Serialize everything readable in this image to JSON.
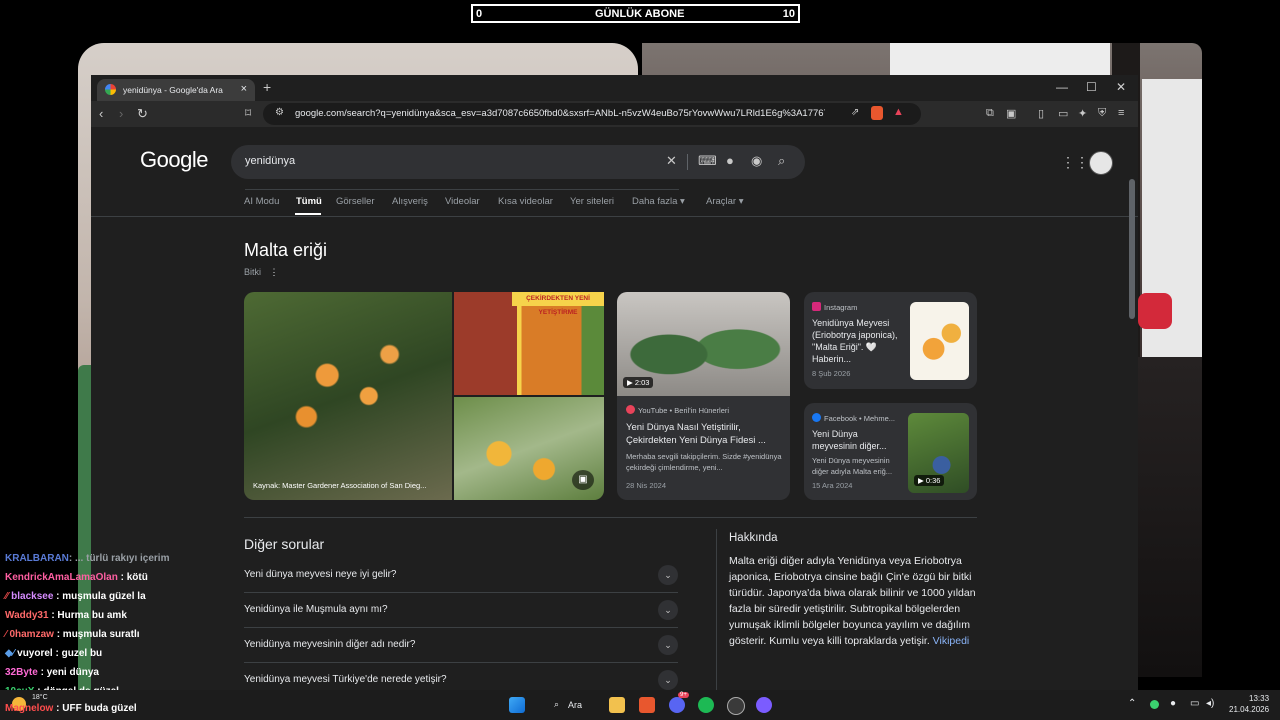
{
  "subscriber_bar": {
    "left": "0",
    "title": "GÜNLÜK ABONE",
    "right": "10"
  },
  "browser": {
    "tab_title": "yenidünya - Google'da Ara",
    "new_tab": "+",
    "url": "google.com/search?q=yenidünya&sca_esv=a3d7087c6650fbd0&sxsrf=ANbL-n5vzW4euBo75rYovwWwu7LRld1E6g%3A17767676245...",
    "window_controls": {
      "minimize": "—",
      "maximize": "☐",
      "close": "✕"
    }
  },
  "google": {
    "logo": "Google",
    "search_query": "yenidünya",
    "tabs": [
      {
        "label": "AI Modu"
      },
      {
        "label": "Tümü"
      },
      {
        "label": "Görseller"
      },
      {
        "label": "Alışveriş"
      },
      {
        "label": "Videolar"
      },
      {
        "label": "Kısa videolar"
      },
      {
        "label": "Yer siteleri"
      },
      {
        "label": "Daha fazla ▾"
      },
      {
        "label": "Araçlar ▾"
      }
    ],
    "kp_title": "Malta eriği",
    "kp_subtitle": "Bitki",
    "image_caption": "Kaynak: Master Gardener Association of San Dieg...",
    "image_banner": "ÇEKİRDEKTEN YENİ YETİŞTİRME",
    "yt_card": {
      "duration": "2:03",
      "source": "YouTube • Beril'in Hünerleri",
      "title": "Yeni Dünya Nasıl Yetiştirilir, Çekirdekten Yeni Dünya Fidesi ...",
      "snippet": "Merhaba sevgili takipçilerim. Sizde #yenidünya çekirdeği çimlendirme, yeni...",
      "date": "28 Nis 2024"
    },
    "ig_card": {
      "source": "Instagram",
      "title": "Yenidünya Meyvesi (Eriobotrya japonica), \"Malta Eriği\". 🤍 Haberin...",
      "date": "8 Şub 2026"
    },
    "fb_card": {
      "source": "Facebook • Mehme...",
      "title": "Yeni Dünya meyvesinin diğer...",
      "snippet": "Yeni Dünya meyvesinin diğer adıyla Malta eriğ...",
      "date": "15 Ara 2024",
      "duration": "0:36"
    },
    "other_questions_title": "Diğer sorular",
    "questions": [
      {
        "text": "Yeni dünya meyvesi neye iyi gelir?"
      },
      {
        "text": "Yenidünya ile Muşmula aynı mı?"
      },
      {
        "text": "Yenidünya meyvesinin diğer adı nedir?"
      },
      {
        "text": "Yenidünya meyvesi Türkiye'de nerede yetişir?"
      }
    ],
    "about_title": "Hakkında",
    "about_text": "Malta eriği diğer adıyla Yenidünya veya Eriobotrya japonica, Eriobotrya cinsine bağlı Çin'e özgü bir bitki türüdür. Japonya'da biwa olarak bilinir ve 1000 yıldan fazla bir süredir yetiştirilir. Subtropikal bölgelerden yumuşak iklimli bölgeler boyunca yayılım ve dağılım gösterir. Kumlu veya killi topraklarda yetişir. ",
    "about_link": "Vikipedi"
  },
  "chat": [
    {
      "user": "KRALBARAN",
      "msg": ": ... türlü rakıyı içerim",
      "color": "#5a7bd6"
    },
    {
      "user": "KendrickAmaLamaOlan",
      "msg": ": kötü",
      "color": "#ff5fa2"
    },
    {
      "user": "blacksee",
      "msg": ": muşmula güzel la",
      "color": "#d78cff"
    },
    {
      "user": "Waddy31",
      "msg": ": Hurma bu amk",
      "color": "#ff6a6a"
    },
    {
      "user": "0hamzaw",
      "msg": ": muşmula suratlı",
      "color": "#ff6a6a"
    },
    {
      "user": "vuyorel",
      "msg": ": guzel bu",
      "color": "#ffffff"
    },
    {
      "user": "32Byte",
      "msg": ": yeni dünya",
      "color": "#ff6ad5"
    },
    {
      "user": "10cuX",
      "msg": ": döngel de güzel",
      "color": "#3bd16f"
    },
    {
      "user": "Magnelow",
      "msg": ": UFF buda güzel",
      "color": "#ff4d4d"
    }
  ],
  "taskbar": {
    "search_label": "Ara",
    "weather": "18°C",
    "time": "13:33",
    "date": "21.04.2026",
    "discord_badge": "9+"
  },
  "colors": {
    "accent_link": "#8ab4f8",
    "page_bg": "#1f1f1f",
    "card_bg": "#303134"
  }
}
